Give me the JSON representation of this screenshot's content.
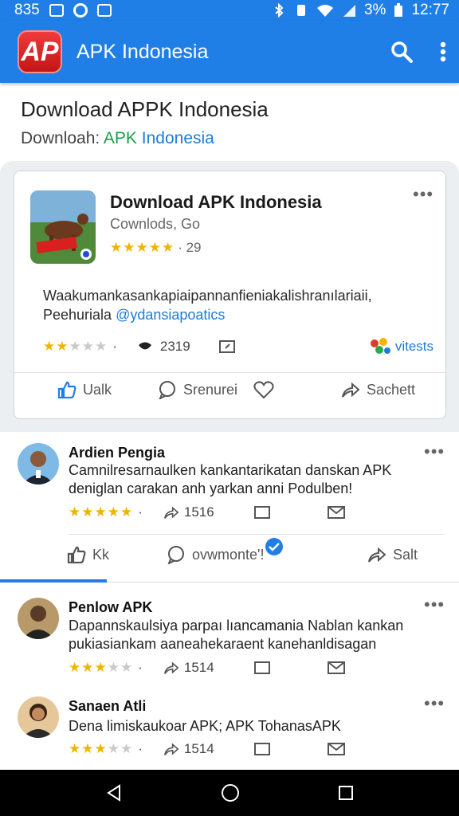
{
  "status_bar": {
    "left_text": "835",
    "battery": "3%",
    "time": "12:77"
  },
  "app_bar": {
    "logo_text": "AP",
    "title": "APK Indonesia",
    "search_icon": "search-icon",
    "menu_icon": "more-vert-icon"
  },
  "header": {
    "title": "Download APPK Indonesia",
    "subtitle_prefix": "Downloah: ",
    "subtitle_accent": "APK",
    "subtitle_accent2": " Indonesia"
  },
  "card": {
    "title": "Download APK Indonesia",
    "subtitle": "Cownlods, Go",
    "stars_on": "★★★★★",
    "rating_count": "· 29",
    "desc_line1": "Waakumankasankapiaipannanfieniakalishranılariaii,",
    "desc_prefix": "Peehuriala ",
    "desc_handle": "@ydansiapoatics",
    "meta_stars_on": "★★",
    "meta_stars_off": "★★★",
    "meta_dot": "·",
    "meta_count": "2319",
    "meta_group_label": "vitests",
    "action_like": "Ualk",
    "action_comment": "Srenurei",
    "action_share": "Sachett"
  },
  "comments": [
    {
      "name": "Ardien Pengia",
      "line1": "Camnilresarnaulken kankantarikatan danskan APK",
      "line2": "deniglan carakan anh yarkan anni Podulben!",
      "stars_on": "★★★★★",
      "stars_off": "",
      "likes": "1516"
    },
    {
      "name": "Penlow APK",
      "line1": "Dapannskaulsiya parpaı lıancamania Nablan kankan",
      "line2": "pukiasiankam aaneahekaraent kanehanldisagan",
      "stars_on": "★★★",
      "stars_off": "★★",
      "likes": "1514"
    },
    {
      "name": "Sanaen Atli",
      "line1": "Dena limiskaukoar APK; APK TohanasAPK",
      "line2": "",
      "stars_on": "★★★",
      "stars_off": "★★",
      "likes": "1514"
    }
  ],
  "comment_actions": {
    "like": "Kk",
    "comment": "ovwmonte'!",
    "share": "Salt"
  },
  "colors": {
    "primary": "#1f7fe6",
    "star": "#f0b400",
    "accent_green": "#1a9e4a",
    "link_blue": "#1e7bd6"
  }
}
